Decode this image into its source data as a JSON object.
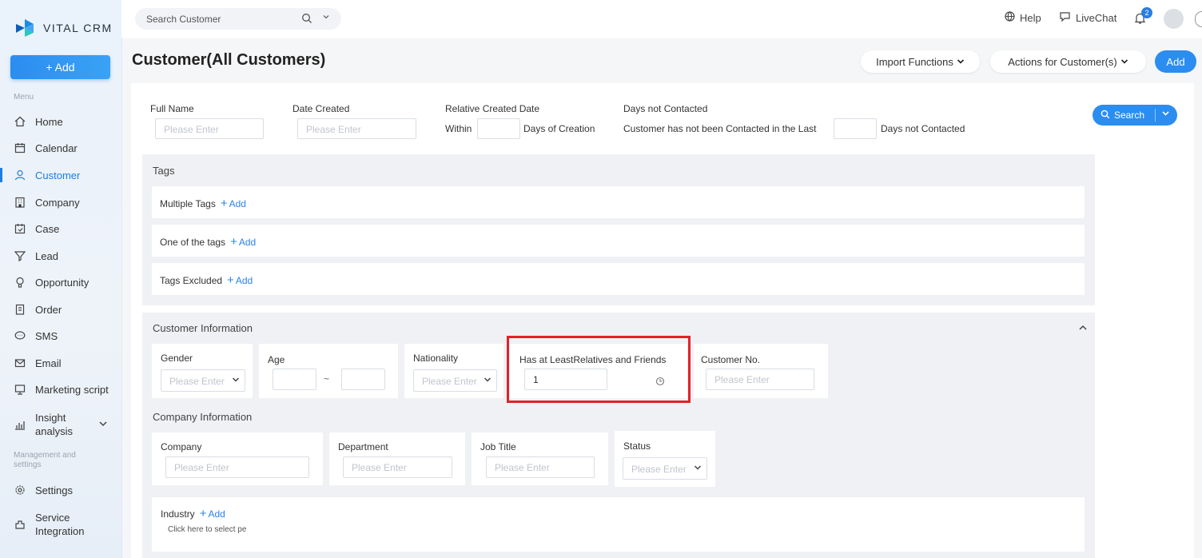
{
  "app": {
    "logo_text": "VITAL CRM"
  },
  "sidebar": {
    "add_label": "+ Add",
    "menu_header": "Menu",
    "items": [
      {
        "label": "Home",
        "icon": "home-icon"
      },
      {
        "label": "Calendar",
        "icon": "calendar-icon"
      },
      {
        "label": "Customer",
        "icon": "user-icon",
        "active": true
      },
      {
        "label": "Company",
        "icon": "building-icon"
      },
      {
        "label": "Case",
        "icon": "case-icon"
      },
      {
        "label": "Lead",
        "icon": "lead-icon"
      },
      {
        "label": "Opportunity",
        "icon": "opportunity-icon"
      },
      {
        "label": "Order",
        "icon": "order-icon"
      },
      {
        "label": "SMS",
        "icon": "sms-icon"
      },
      {
        "label": "Email",
        "icon": "email-icon"
      },
      {
        "label": "Marketing script",
        "icon": "script-icon"
      }
    ],
    "insight_line1": "Insight",
    "insight_line2": "analysis",
    "mgmt_header_line1": "Management and",
    "mgmt_header_line2": "settings",
    "settings_label": "Settings",
    "service_line1": "Service",
    "service_line2": "Integration"
  },
  "topbar": {
    "search_placeholder": "Search Customer",
    "help_label": "Help",
    "livechat_label": "LiveChat",
    "notification_count": "2"
  },
  "header": {
    "title": "Customer(All Customers)",
    "import_label": "Import Functions",
    "actions_label": "Actions for Customer(s)",
    "add_label": "Add"
  },
  "filters": {
    "full_name_label": "Full Name",
    "full_name_placeholder": "Please Enter",
    "date_created_label": "Date Created",
    "date_created_placeholder": "Please Enter",
    "relative_label": "Relative Created Date",
    "within_label": "Within",
    "days_creation_label": "Days of Creation",
    "not_contacted_label": "Days not Contacted",
    "not_contacted_prefix": "Customer has not been Contacted in the Last",
    "not_contacted_suffix": "Days not Contacted",
    "search_button": "Search"
  },
  "tags": {
    "title": "Tags",
    "multiple_label": "Multiple Tags",
    "one_of_label": "One of the tags",
    "excluded_label": "Tags Excluded",
    "add_label": "Add"
  },
  "customer_info": {
    "title": "Customer Information",
    "gender_label": "Gender",
    "gender_placeholder": "Please Enter",
    "age_label": "Age",
    "age_sep": "~",
    "nationality_label": "Nationality",
    "nationality_placeholder": "Please Enter",
    "relatives_label": "Has at LeastRelatives and Friends",
    "relatives_value": "1",
    "customer_no_label": "Customer No.",
    "customer_no_placeholder": "Please Enter"
  },
  "company_info": {
    "title": "Company Information",
    "company_label": "Company",
    "company_placeholder": "Please Enter",
    "department_label": "Department",
    "department_placeholder": "Please Enter",
    "job_title_label": "Job Title",
    "job_title_placeholder": "Please Enter",
    "status_label": "Status",
    "status_placeholder": "Please Enter",
    "industry_label": "Industry",
    "industry_add": "Add",
    "industry_hint": "Click here to select pe"
  }
}
